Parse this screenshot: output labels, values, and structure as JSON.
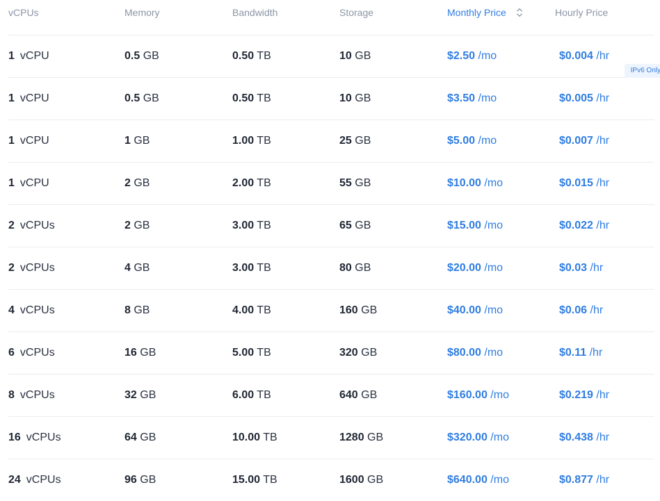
{
  "header": {
    "vcpus": "vCPUs",
    "memory": "Memory",
    "bandwidth": "Bandwidth",
    "storage": "Storage",
    "monthly": "Monthly Price",
    "hourly": "Hourly Price"
  },
  "badge": "IPv6 Only",
  "accent_color": "#2f7de1",
  "rows": [
    {
      "cpu": "1",
      "cpu_unit": "vCPU",
      "mem": "0.5",
      "mem_unit": "GB",
      "bw": "0.50",
      "bw_unit": "TB",
      "st": "10",
      "st_unit": "GB",
      "mo": "$2.50",
      "mo_unit": "/mo",
      "hr": "$0.004",
      "hr_unit": "/hr"
    },
    {
      "cpu": "1",
      "cpu_unit": "vCPU",
      "mem": "0.5",
      "mem_unit": "GB",
      "bw": "0.50",
      "bw_unit": "TB",
      "st": "10",
      "st_unit": "GB",
      "mo": "$3.50",
      "mo_unit": "/mo",
      "hr": "$0.005",
      "hr_unit": "/hr"
    },
    {
      "cpu": "1",
      "cpu_unit": "vCPU",
      "mem": "1",
      "mem_unit": "GB",
      "bw": "1.00",
      "bw_unit": "TB",
      "st": "25",
      "st_unit": "GB",
      "mo": "$5.00",
      "mo_unit": "/mo",
      "hr": "$0.007",
      "hr_unit": "/hr"
    },
    {
      "cpu": "1",
      "cpu_unit": "vCPU",
      "mem": "2",
      "mem_unit": "GB",
      "bw": "2.00",
      "bw_unit": "TB",
      "st": "55",
      "st_unit": "GB",
      "mo": "$10.00",
      "mo_unit": "/mo",
      "hr": "$0.015",
      "hr_unit": "/hr"
    },
    {
      "cpu": "2",
      "cpu_unit": "vCPUs",
      "mem": "2",
      "mem_unit": "GB",
      "bw": "3.00",
      "bw_unit": "TB",
      "st": "65",
      "st_unit": "GB",
      "mo": "$15.00",
      "mo_unit": "/mo",
      "hr": "$0.022",
      "hr_unit": "/hr"
    },
    {
      "cpu": "2",
      "cpu_unit": "vCPUs",
      "mem": "4",
      "mem_unit": "GB",
      "bw": "3.00",
      "bw_unit": "TB",
      "st": "80",
      "st_unit": "GB",
      "mo": "$20.00",
      "mo_unit": "/mo",
      "hr": "$0.03",
      "hr_unit": "/hr"
    },
    {
      "cpu": "4",
      "cpu_unit": "vCPUs",
      "mem": "8",
      "mem_unit": "GB",
      "bw": "4.00",
      "bw_unit": "TB",
      "st": "160",
      "st_unit": "GB",
      "mo": "$40.00",
      "mo_unit": "/mo",
      "hr": "$0.06",
      "hr_unit": "/hr"
    },
    {
      "cpu": "6",
      "cpu_unit": "vCPUs",
      "mem": "16",
      "mem_unit": "GB",
      "bw": "5.00",
      "bw_unit": "TB",
      "st": "320",
      "st_unit": "GB",
      "mo": "$80.00",
      "mo_unit": "/mo",
      "hr": "$0.11",
      "hr_unit": "/hr"
    },
    {
      "cpu": "8",
      "cpu_unit": "vCPUs",
      "mem": "32",
      "mem_unit": "GB",
      "bw": "6.00",
      "bw_unit": "TB",
      "st": "640",
      "st_unit": "GB",
      "mo": "$160.00",
      "mo_unit": "/mo",
      "hr": "$0.219",
      "hr_unit": "/hr"
    },
    {
      "cpu": "16",
      "cpu_unit": "vCPUs",
      "mem": "64",
      "mem_unit": "GB",
      "bw": "10.00",
      "bw_unit": "TB",
      "st": "1280",
      "st_unit": "GB",
      "mo": "$320.00",
      "mo_unit": "/mo",
      "hr": "$0.438",
      "hr_unit": "/hr"
    },
    {
      "cpu": "24",
      "cpu_unit": "vCPUs",
      "mem": "96",
      "mem_unit": "GB",
      "bw": "15.00",
      "bw_unit": "TB",
      "st": "1600",
      "st_unit": "GB",
      "mo": "$640.00",
      "mo_unit": "/mo",
      "hr": "$0.877",
      "hr_unit": "/hr"
    }
  ]
}
